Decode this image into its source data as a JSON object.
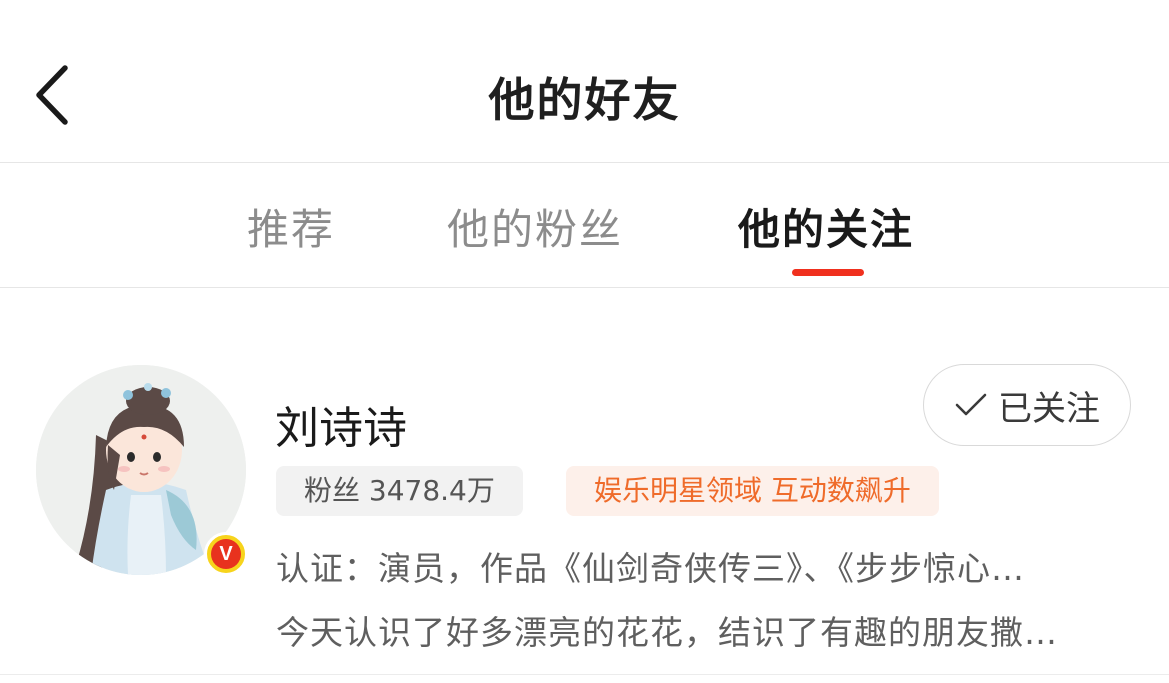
{
  "header": {
    "back_icon": "chevron-left-icon",
    "title": "他的好友"
  },
  "tabs": [
    {
      "label": "推荐",
      "active": false
    },
    {
      "label": "他的粉丝",
      "active": false
    },
    {
      "label": "他的关注",
      "active": true
    }
  ],
  "accent_color": "#f0301e",
  "user": {
    "name": "刘诗诗",
    "avatar_icon": "avatar-illustration",
    "verified_badge": "V",
    "verified_color": "#f7d41c",
    "follow_button": {
      "icon": "check-icon",
      "label": "已关注"
    },
    "fans_label": "粉丝 3478.4万",
    "domain_label": "娱乐明星领域 互动数飙升",
    "domain_color": "#ef6b2a",
    "verification": "认证：演员，作品《仙剑奇侠传三》、《步步惊心…",
    "bio": "今天认识了好多漂亮的花花，结识了有趣的朋友撒…"
  }
}
